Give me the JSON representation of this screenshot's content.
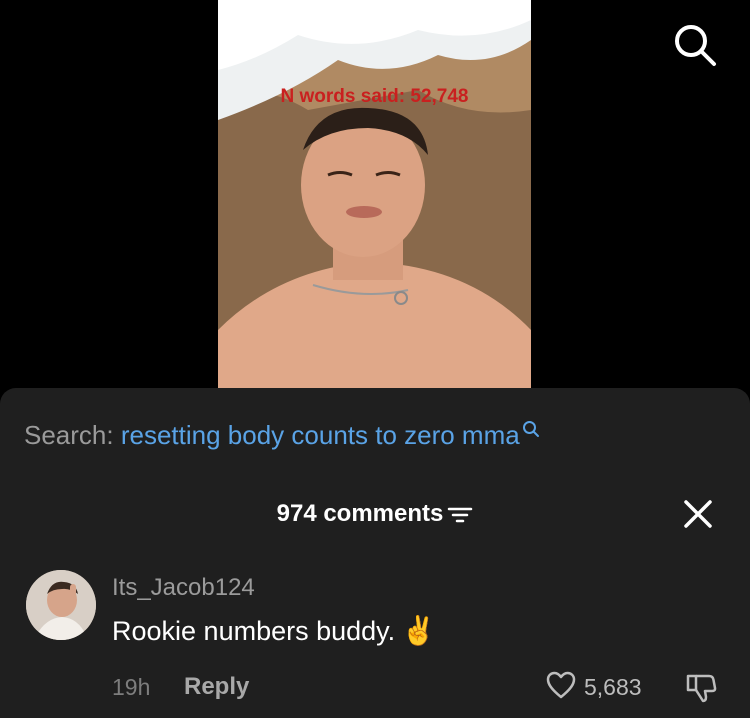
{
  "video": {
    "overlay_text": "N words said: 52,748"
  },
  "header": {
    "search_icon": "search-icon"
  },
  "search": {
    "label": "Search:",
    "query": "resetting body counts to zero mma"
  },
  "comments": {
    "count_label": "974 comments",
    "filter_icon": "filter-icon",
    "close_icon": "close-icon",
    "items": [
      {
        "username": "Its_Jacob124",
        "text": "Rookie numbers buddy.",
        "emoji": "✌️",
        "time": "19h",
        "reply_label": "Reply",
        "likes": "5,683"
      }
    ]
  },
  "colors": {
    "panel_bg": "#1f1f1f",
    "link_blue": "#5aa3e6",
    "overlay_red": "#c9201f"
  }
}
